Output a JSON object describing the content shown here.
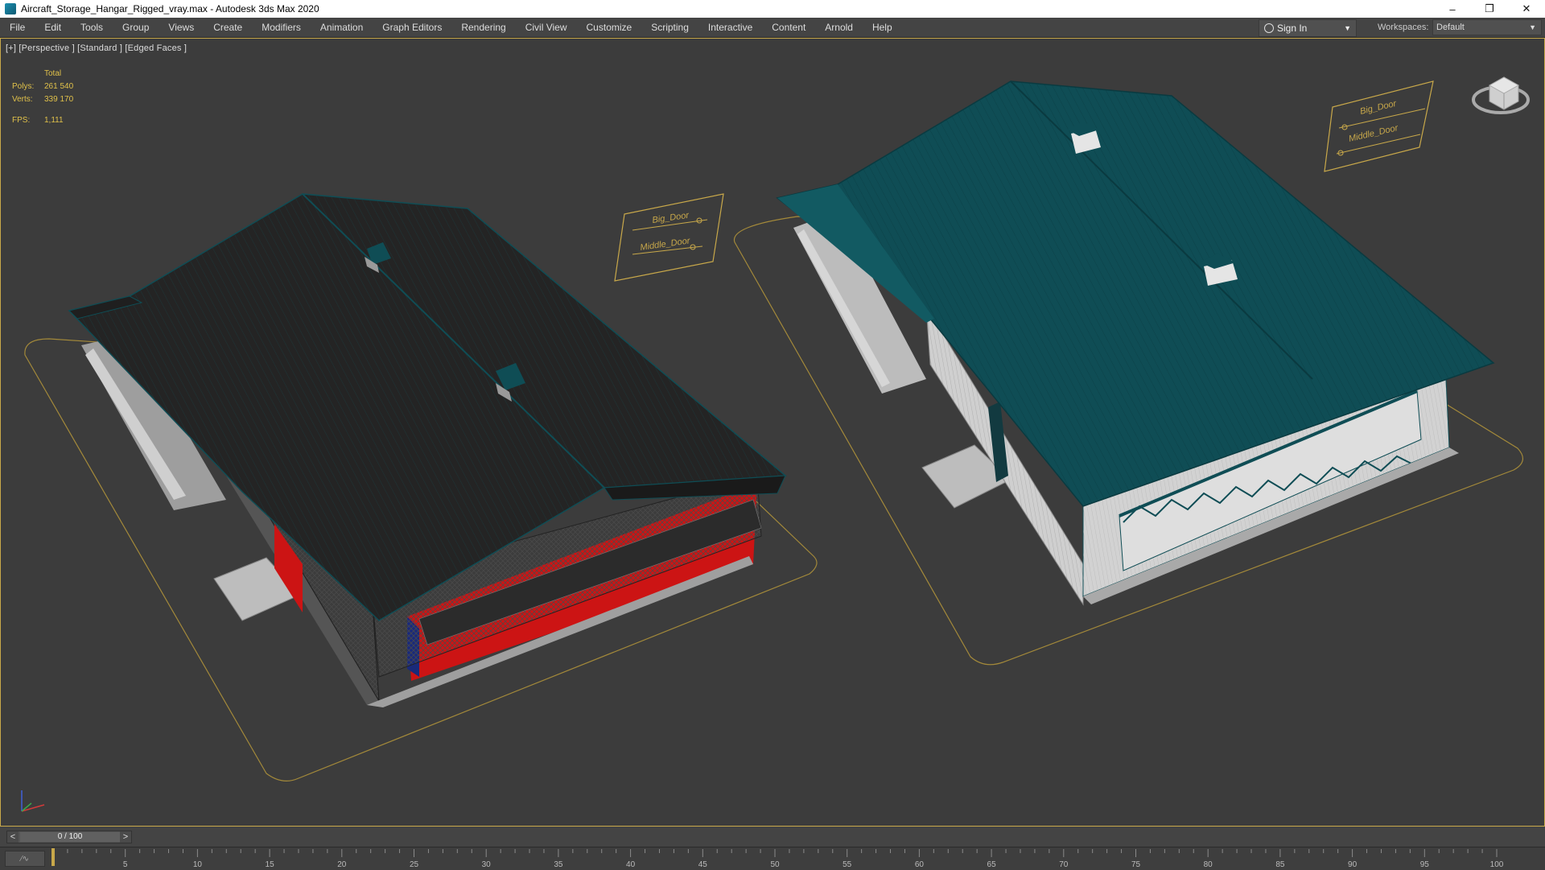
{
  "window": {
    "title": "Aircraft_Storage_Hangar_Rigged_vray.max - Autodesk 3ds Max 2020",
    "minimize": "–",
    "restore": "❐",
    "close": "✕"
  },
  "menu": [
    "File",
    "Edit",
    "Tools",
    "Group",
    "Views",
    "Create",
    "Modifiers",
    "Animation",
    "Graph Editors",
    "Rendering",
    "Civil View",
    "Customize",
    "Scripting",
    "Interactive",
    "Content",
    "Arnold",
    "Help"
  ],
  "account": {
    "sign_in": "Sign In",
    "caret": "▼"
  },
  "workspaces": {
    "label": "Workspaces:",
    "value": "Default",
    "caret": "▼"
  },
  "viewport": {
    "label": "[+] [Perspective ] [Standard ] [Edged Faces ]",
    "stats": {
      "header": "Total",
      "polys_label": "Polys:",
      "polys": "261 540",
      "verts_label": "Verts:",
      "verts": "339 170",
      "fps_label": "FPS:",
      "fps": "1,111"
    },
    "controllers": [
      {
        "big": "Big_Door",
        "middle": "Middle_Door"
      },
      {
        "big": "Big_Door",
        "middle": "Middle_Door"
      }
    ]
  },
  "timeline": {
    "frame": "0 / 100",
    "prev": "<",
    "next": ">",
    "ticks": [
      "5",
      "10",
      "15",
      "20",
      "25",
      "30",
      "35",
      "40",
      "45",
      "50",
      "55",
      "60",
      "65",
      "70",
      "75",
      "80",
      "85",
      "90",
      "95",
      "100"
    ]
  },
  "colors": {
    "accent": "#c8a84a",
    "roof_teal": "#0f4d55",
    "roof_dark": "#222222",
    "wall_light": "#c9c9c9",
    "door_red": "#cc1414"
  }
}
